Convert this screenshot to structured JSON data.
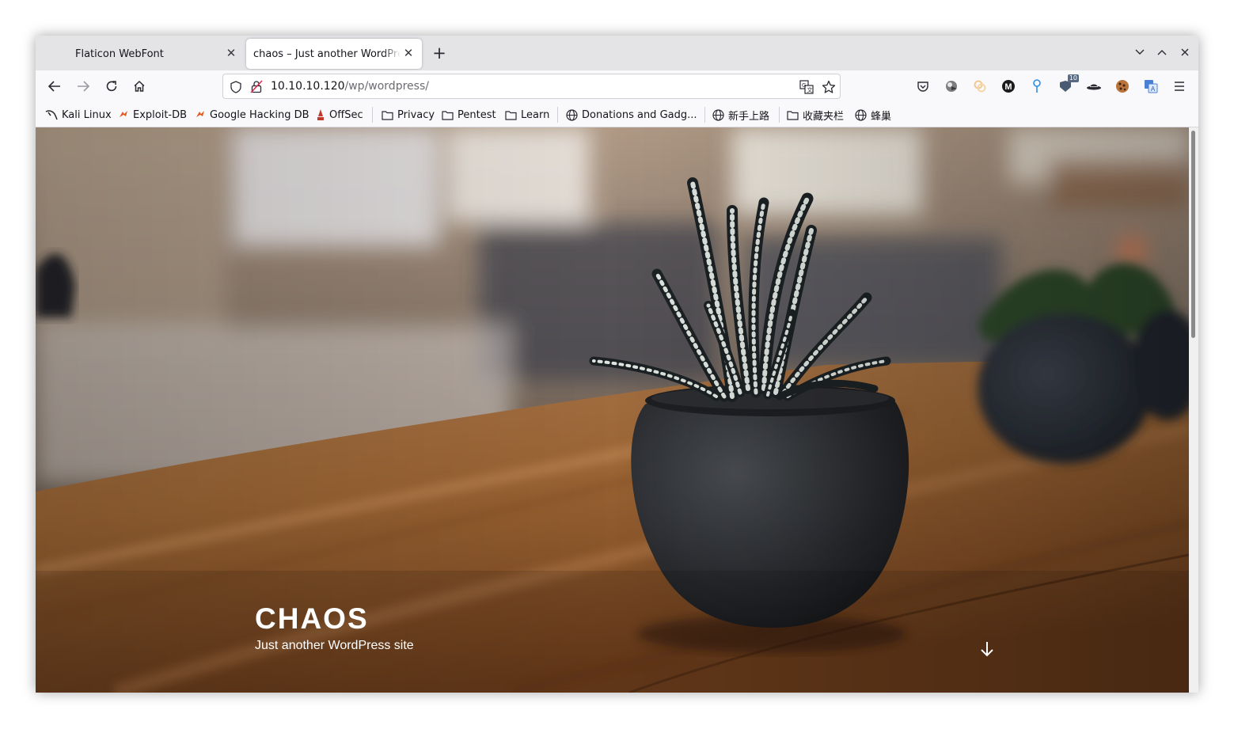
{
  "tabs": [
    {
      "label": "Flaticon WebFont",
      "active": false
    },
    {
      "label": "chaos – Just another WordPress site",
      "active": true
    }
  ],
  "navigation": {
    "url_host": "10.10.10.120",
    "url_path": "/wp/wordpress/"
  },
  "extensions": {
    "badge_count": "10"
  },
  "bookmarks": [
    {
      "label": "Kali Linux",
      "icon": "kali-icon"
    },
    {
      "label": "Exploit-DB",
      "icon": "exploitdb-icon"
    },
    {
      "label": "Google Hacking DB",
      "icon": "exploitdb-icon"
    },
    {
      "label": "OffSec",
      "icon": "offsec-icon"
    },
    {
      "label": "Privacy",
      "icon": "folder-icon"
    },
    {
      "label": "Pentest",
      "icon": "folder-icon"
    },
    {
      "label": "Learn",
      "icon": "folder-icon"
    },
    {
      "label": "Donations and Gadg...",
      "icon": "globe-icon"
    },
    {
      "label": "新手上路",
      "icon": "globe-icon"
    },
    {
      "label": "收藏夹栏",
      "icon": "folder-icon"
    },
    {
      "label": "蜂巢",
      "icon": "globe-icon"
    }
  ],
  "hero": {
    "title": "CHAOS",
    "tagline": "Just another WordPress site"
  }
}
